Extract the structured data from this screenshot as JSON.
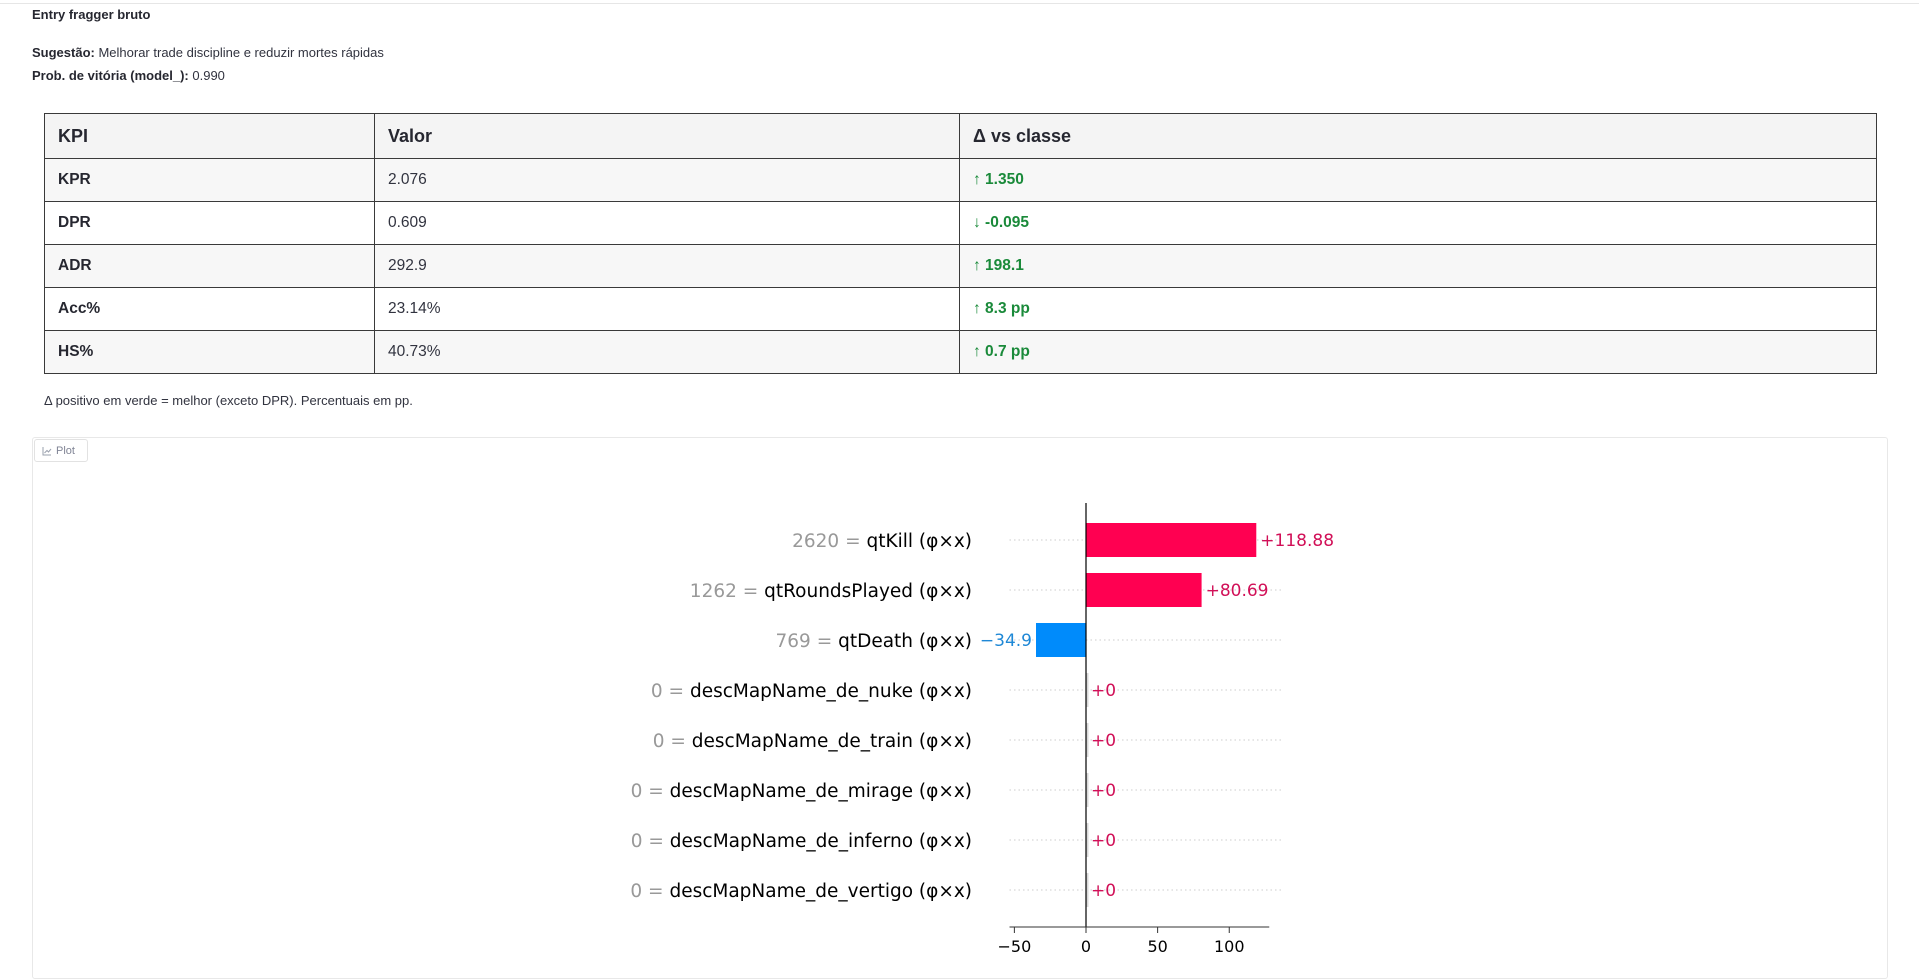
{
  "header": {
    "subheading": "Entry fragger bruto",
    "suggestion_label": "Sugestão:",
    "suggestion_text": "Melhorar trade discipline e reduzir mortes rápidas",
    "prob_label": "Prob. de vitória (model_):",
    "prob_value": "0.990"
  },
  "table": {
    "headers": [
      "KPI",
      "Valor",
      "Δ vs classe"
    ],
    "rows": [
      {
        "kpi": "KPR",
        "valor": "2.076",
        "delta": "↑ 1.350"
      },
      {
        "kpi": "DPR",
        "valor": "0.609",
        "delta": "↓ -0.095"
      },
      {
        "kpi": "ADR",
        "valor": "292.9",
        "delta": "↑ 198.1"
      },
      {
        "kpi": "Acc%",
        "valor": "23.14%",
        "delta": "↑ 8.3 pp"
      },
      {
        "kpi": "HS%",
        "valor": "40.73%",
        "delta": "↑ 0.7 pp"
      }
    ],
    "delta_color": "#1a8a3a"
  },
  "note": "Δ positivo em verde = melhor (exceto DPR). Percentuais em pp.",
  "plot_tab": {
    "label": "Plot",
    "icon": "chart-icon"
  },
  "chart_data": {
    "type": "bar",
    "orientation": "horizontal",
    "features": [
      {
        "value_label": "2620",
        "name": "qtKill (φ×x)",
        "contribution": 118.88,
        "label": "+118.88"
      },
      {
        "value_label": "1262",
        "name": "qtRoundsPlayed (φ×x)",
        "contribution": 80.69,
        "label": "+80.69"
      },
      {
        "value_label": "769",
        "name": "qtDeath (φ×x)",
        "contribution": -34.9,
        "label": "−34.9"
      },
      {
        "value_label": "0",
        "name": "descMapName_de_nuke (φ×x)",
        "contribution": 0,
        "label": "+0"
      },
      {
        "value_label": "0",
        "name": "descMapName_de_train (φ×x)",
        "contribution": 0,
        "label": "+0"
      },
      {
        "value_label": "0",
        "name": "descMapName_de_mirage (φ×x)",
        "contribution": 0,
        "label": "+0"
      },
      {
        "value_label": "0",
        "name": "descMapName_de_inferno (φ×x)",
        "contribution": 0,
        "label": "+0"
      },
      {
        "value_label": "0",
        "name": "descMapName_de_vertigo (φ×x)",
        "contribution": 0,
        "label": "+0"
      }
    ],
    "xticks": [
      -50,
      0,
      50,
      100
    ],
    "xtick_labels": [
      "−50",
      "0",
      "50",
      "100"
    ],
    "xlim": [
      -52,
      135
    ],
    "positive_color": "#ff0051",
    "negative_color": "#008bfb",
    "zero_color": "#d9d9d9",
    "text_positive_color": "#d10f57",
    "text_negative_color": "#1f88d6"
  }
}
